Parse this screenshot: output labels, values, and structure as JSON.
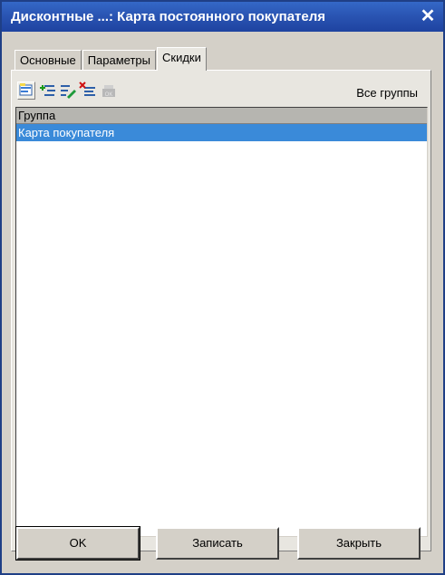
{
  "window": {
    "title": "Дисконтные ...: Карта постоянного покупателя",
    "close_icon": "close-icon"
  },
  "tabs": [
    {
      "label": "Основные",
      "active": false
    },
    {
      "label": "Параметры",
      "active": false
    },
    {
      "label": "Скидки",
      "active": true
    }
  ],
  "toolbar": {
    "icons": [
      "new-group-icon",
      "add-child-icon",
      "edit-icon",
      "delete-icon",
      "ok-disabled-icon"
    ],
    "filter_label": "Все группы"
  },
  "list": {
    "header": "Группа",
    "rows": [
      "Карта покупателя"
    ],
    "selected_row_color": "#3a8ad9"
  },
  "buttons": {
    "ok": "OK",
    "save": "Записать",
    "close": "Закрыть"
  },
  "colors": {
    "title_bar": "#2a55b3",
    "window_bg": "#d4d0c8"
  }
}
